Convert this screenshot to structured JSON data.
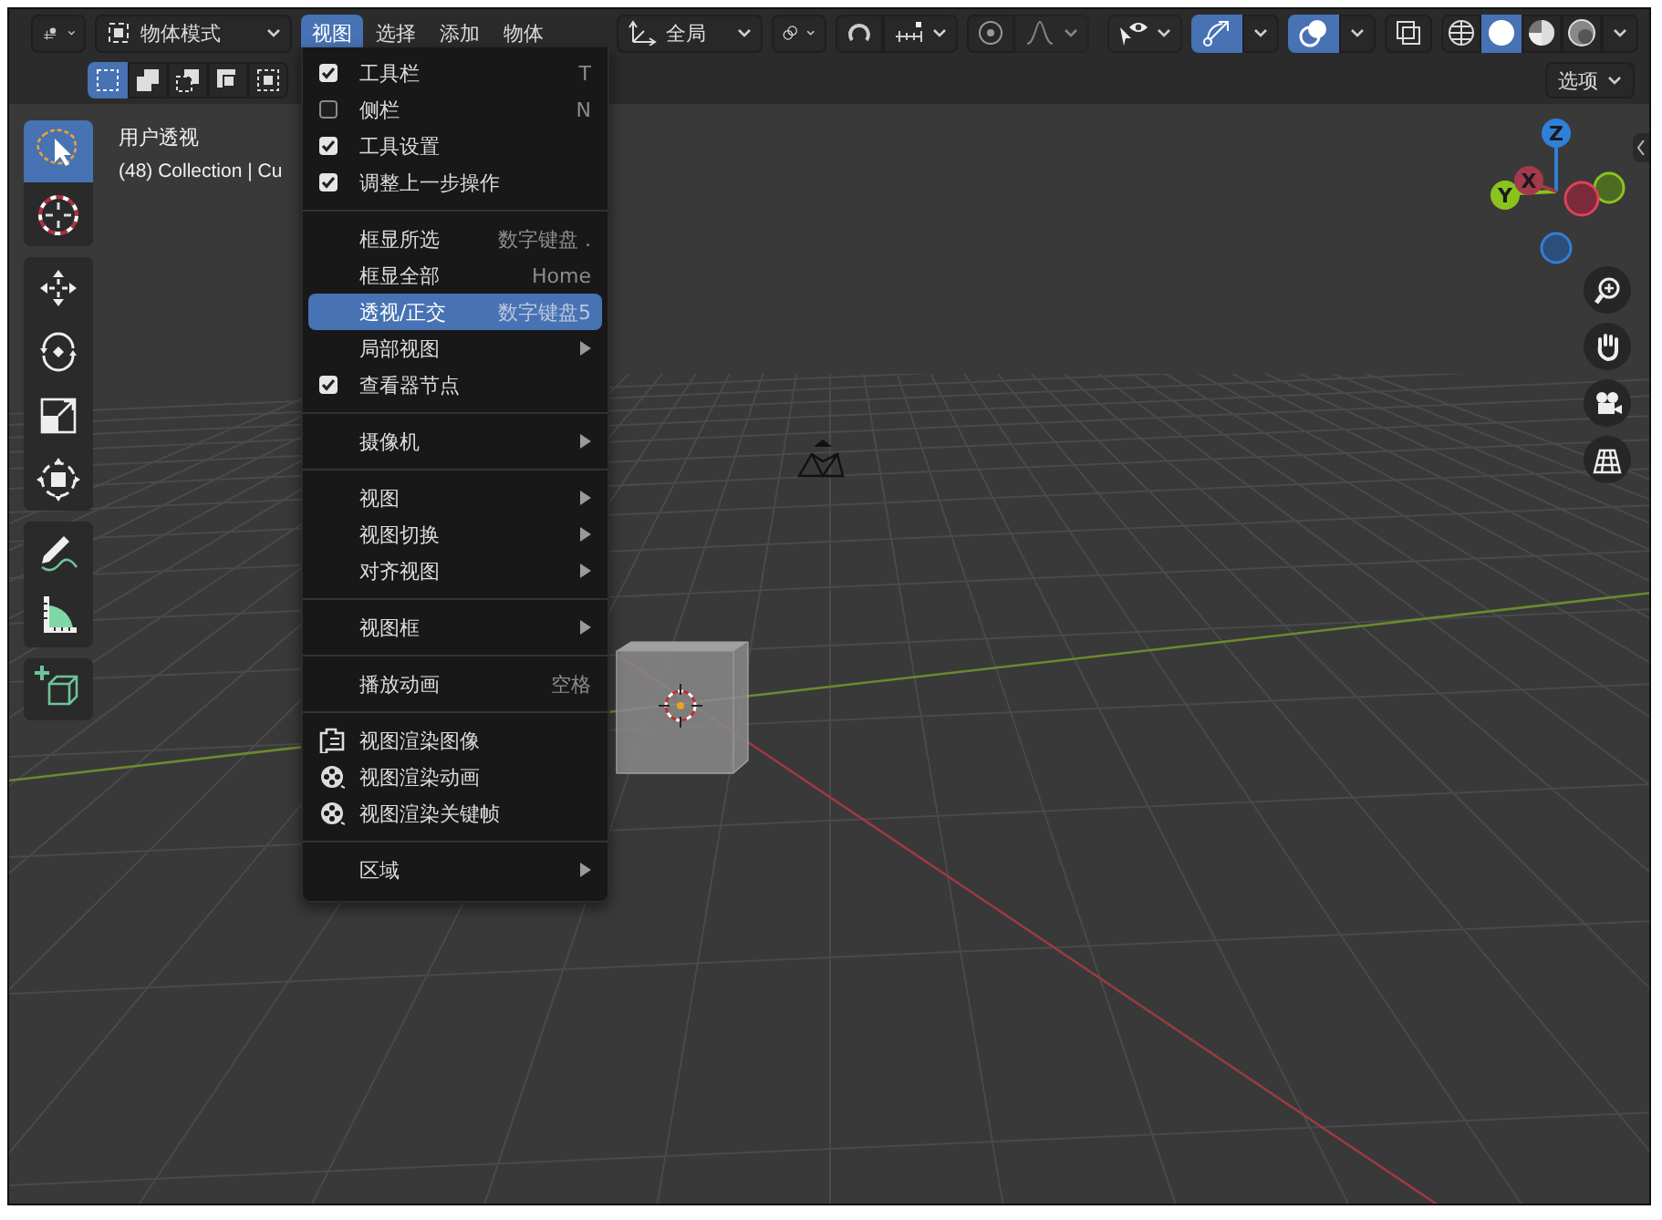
{
  "header": {
    "mode": {
      "label": "物体模式"
    },
    "menus": [
      {
        "label": "视图",
        "selected": true
      },
      {
        "label": "选择",
        "selected": false
      },
      {
        "label": "添加",
        "selected": false
      },
      {
        "label": "物体",
        "selected": false
      }
    ],
    "orientation": {
      "label": "全局"
    },
    "snap": {
      "on": false
    },
    "proportional_editing": {
      "on": false
    },
    "gizmos": {
      "on": true
    },
    "overlays": {
      "on": true
    },
    "xray": {
      "on": false
    },
    "shading_modes": [
      {
        "kind": "wireframe",
        "selected": false
      },
      {
        "kind": "solid",
        "selected": true
      },
      {
        "kind": "material",
        "selected": false
      },
      {
        "kind": "rendered",
        "selected": false
      }
    ]
  },
  "select_modes": [
    {
      "kind": "set",
      "selected": true
    },
    {
      "kind": "extend",
      "selected": false
    },
    {
      "kind": "subtract",
      "selected": false
    },
    {
      "kind": "invert",
      "selected": false
    },
    {
      "kind": "intersect",
      "selected": false
    }
  ],
  "options_button": {
    "label": "选项"
  },
  "viewport_info": {
    "view_name": "用户透视",
    "collection": "(48) Collection | Cu"
  },
  "toolbar": [
    [
      {
        "kind": "select",
        "selected": true
      },
      {
        "kind": "cursor",
        "selected": false
      }
    ],
    [
      {
        "kind": "move",
        "selected": false
      },
      {
        "kind": "rotate",
        "selected": false
      },
      {
        "kind": "scale",
        "selected": false
      },
      {
        "kind": "transform",
        "selected": false
      }
    ],
    [
      {
        "kind": "annotate",
        "selected": false
      },
      {
        "kind": "measure",
        "selected": false
      }
    ],
    [
      {
        "kind": "add_cube",
        "selected": false
      }
    ]
  ],
  "view_menu": {
    "sections": [
      [
        {
          "kind": "check",
          "label": "工具栏",
          "checked": true,
          "shortcut": "T",
          "selected": false
        },
        {
          "kind": "check",
          "label": "侧栏",
          "checked": false,
          "shortcut": "N",
          "selected": false
        },
        {
          "kind": "check",
          "label": "工具设置",
          "checked": true,
          "selected": false
        },
        {
          "kind": "check",
          "label": "调整上一步操作",
          "checked": true,
          "selected": false
        }
      ],
      [
        {
          "kind": "plain",
          "label": "框显所选",
          "shortcut": "数字键盘 .",
          "selected": false
        },
        {
          "kind": "plain",
          "label": "框显全部",
          "shortcut": "Home",
          "selected": false
        },
        {
          "kind": "plain",
          "label": "透视/正交",
          "shortcut": "数字键盘5",
          "selected": true
        },
        {
          "kind": "submenu",
          "label": "局部视图",
          "selected": false
        },
        {
          "kind": "check",
          "label": "查看器节点",
          "checked": true,
          "selected": false
        }
      ],
      [
        {
          "kind": "submenu",
          "label": "摄像机",
          "selected": false
        }
      ],
      [
        {
          "kind": "submenu",
          "label": "视图",
          "selected": false
        },
        {
          "kind": "submenu",
          "label": "视图切换",
          "selected": false
        },
        {
          "kind": "submenu",
          "label": "对齐视图",
          "selected": false
        }
      ],
      [
        {
          "kind": "submenu",
          "label": "视图框",
          "selected": false
        }
      ],
      [
        {
          "kind": "plain",
          "label": "播放动画",
          "shortcut": "空格",
          "selected": false
        }
      ],
      [
        {
          "kind": "render_still",
          "label": "视图渲染图像",
          "selected": false
        },
        {
          "kind": "render_reel",
          "label": "视图渲染动画",
          "selected": false
        },
        {
          "kind": "render_reel",
          "label": "视图渲染关键帧",
          "selected": false
        }
      ],
      [
        {
          "kind": "submenu",
          "label": "区域",
          "selected": false
        }
      ]
    ]
  },
  "gizmo": {
    "axes": [
      {
        "label": "Z",
        "color": "#2f80d8"
      },
      {
        "label": "Y",
        "color": "#8bc31d"
      },
      {
        "label": "X",
        "color": "#a33a4c"
      }
    ]
  }
}
